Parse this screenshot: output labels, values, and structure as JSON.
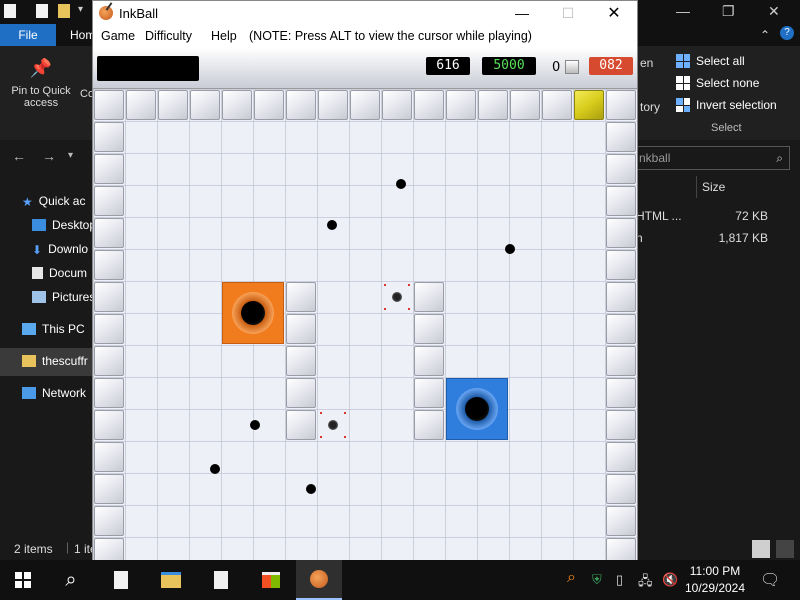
{
  "explorer": {
    "ribbon": {
      "file_tab": "File",
      "home_tab": "Hom",
      "pin_label_1": "Pin to Quick",
      "pin_label_2": "access",
      "co_label": "Co",
      "open_fragment": "en",
      "history_fragment": "tory",
      "select_all": "Select all",
      "select_none": "Select none",
      "invert_selection": "Invert selection",
      "select_group": "Select"
    },
    "search_text": "nkball",
    "nav_items": [
      "Quick ac",
      "Desktop",
      "Downlo",
      "Docum",
      "Pictures",
      "This PC",
      "thescuffr",
      "Network"
    ],
    "size_header": "Size",
    "files": [
      {
        "name": "HTML ...",
        "size": "72 KB"
      },
      {
        "name": "n",
        "size": "1,817 KB"
      }
    ],
    "status_items": "2 items",
    "status_sep": "|",
    "status_selected": "1 ite"
  },
  "inkball": {
    "title": "InkBall",
    "menu": {
      "game": "Game",
      "difficulty": "Difficulty",
      "help": "Help",
      "note": "(NOTE: Press ALT to view the cursor while playing)"
    },
    "scoreboard": {
      "time": "616",
      "target": "5000",
      "lost_count": "0",
      "score": "082"
    },
    "colors": {
      "time_text": "#ffffff",
      "target_text": "#5be05b",
      "score_bg": "#d64b2f",
      "orange_hole": "#f07c1e",
      "blue_hole": "#2f7ddc",
      "gold_block": "#d8cc1c"
    }
  },
  "taskbar": {
    "time": "11:00 PM",
    "date": "10/29/2024"
  }
}
